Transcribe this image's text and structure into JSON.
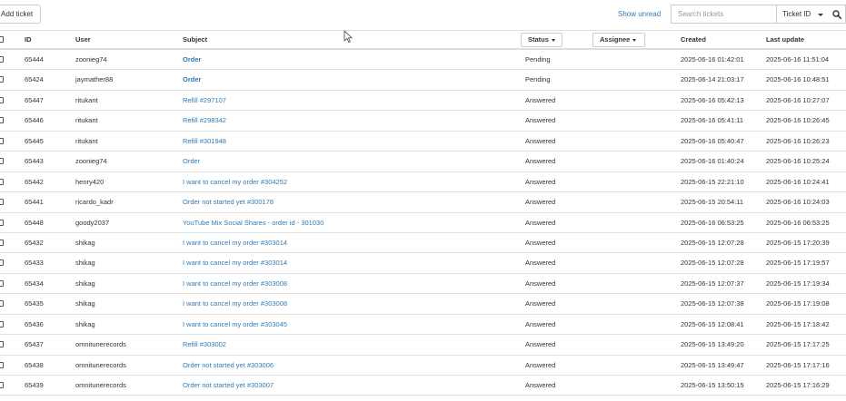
{
  "toolbar": {
    "add_ticket_label": "Add ticket",
    "show_unread_label": "Show unread",
    "search_placeholder": "Search tickets",
    "search_field_selected": "Ticket ID"
  },
  "table": {
    "headers": {
      "id": "ID",
      "user": "User",
      "subject": "Subject",
      "status": "Status",
      "assignee": "Assignee",
      "created": "Created",
      "last_update": "Last update"
    },
    "rows": [
      {
        "id": "65444",
        "user": "zoonieg74",
        "subject": "Order",
        "unread": true,
        "status": "Pending",
        "created": "2025-06-16 01:42:01",
        "updated": "2025-06-16 11:51:04"
      },
      {
        "id": "65424",
        "user": "jaymather88",
        "subject": "Order",
        "unread": true,
        "status": "Pending",
        "created": "2025-06-14 21:03:17",
        "updated": "2025-06-16 10:48:51"
      },
      {
        "id": "65447",
        "user": "ritukant",
        "subject": "Refill #297107",
        "unread": false,
        "status": "Answered",
        "created": "2025-06-16 05:42:13",
        "updated": "2025-06-16 10:27:07"
      },
      {
        "id": "65446",
        "user": "ritukant",
        "subject": "Refill #298342",
        "unread": false,
        "status": "Answered",
        "created": "2025-06-16 05:41:11",
        "updated": "2025-06-16 10:26:45"
      },
      {
        "id": "65445",
        "user": "ritukant",
        "subject": "Refill #301948",
        "unread": false,
        "status": "Answered",
        "created": "2025-06-16 05:40:47",
        "updated": "2025-06-16 10:26:23"
      },
      {
        "id": "65443",
        "user": "zoonieg74",
        "subject": "Order",
        "unread": false,
        "status": "Answered",
        "created": "2025-06-16 01:40:24",
        "updated": "2025-06-16 10:25:24"
      },
      {
        "id": "65442",
        "user": "henry420",
        "subject": "I want to cancel my order #304252",
        "unread": false,
        "status": "Answered",
        "created": "2025-06-15 22:21:10",
        "updated": "2025-06-16 10:24:41"
      },
      {
        "id": "65441",
        "user": "ricardo_kadr",
        "subject": "Order not started yet #300178",
        "unread": false,
        "status": "Answered",
        "created": "2025-06-15 20:54:11",
        "updated": "2025-06-16 10:24:03"
      },
      {
        "id": "65448",
        "user": "goody2037",
        "subject": "YouTube Mix Social Shares - order id - 301030",
        "unread": false,
        "status": "Answered",
        "created": "2025-06-16 06:53:25",
        "updated": "2025-06-16 06:53:25"
      },
      {
        "id": "65432",
        "user": "shikag",
        "subject": "I want to cancel my order #303014",
        "unread": false,
        "status": "Answered",
        "created": "2025-06-15 12:07:28",
        "updated": "2025-06-15 17:20:39"
      },
      {
        "id": "65433",
        "user": "shikag",
        "subject": "I want to cancel my order #303014",
        "unread": false,
        "status": "Answered",
        "created": "2025-06-15 12:07:28",
        "updated": "2025-06-15 17:19:57"
      },
      {
        "id": "65434",
        "user": "shikag",
        "subject": "I want to cancel my order #303008",
        "unread": false,
        "status": "Answered",
        "created": "2025-06-15 12:07:37",
        "updated": "2025-06-15 17:19:34"
      },
      {
        "id": "65435",
        "user": "shikag",
        "subject": "I want to cancel my order #303008",
        "unread": false,
        "status": "Answered",
        "created": "2025-06-15 12:07:38",
        "updated": "2025-06-15 17:19:08"
      },
      {
        "id": "65436",
        "user": "shikag",
        "subject": "I want to cancel my order #303045",
        "unread": false,
        "status": "Answered",
        "created": "2025-06-15 12:08:41",
        "updated": "2025-06-15 17:18:42"
      },
      {
        "id": "65437",
        "user": "omnitunerecords",
        "subject": "Refill #303002",
        "unread": false,
        "status": "Answered",
        "created": "2025-06-15 13:49:20",
        "updated": "2025-06-15 17:17:25"
      },
      {
        "id": "65438",
        "user": "omnitunerecords",
        "subject": "Order not started yet #303006",
        "unread": false,
        "status": "Answered",
        "created": "2025-06-15 13:49:47",
        "updated": "2025-06-15 17:17:16"
      },
      {
        "id": "65439",
        "user": "omnitunerecords",
        "subject": "Order not started yet #303007",
        "unread": false,
        "status": "Answered",
        "created": "2025-06-15 13:50:15",
        "updated": "2025-06-15 17:16:29"
      }
    ]
  },
  "colors": {
    "link": "#337ab7",
    "text": "#333333",
    "border": "#dddddd"
  },
  "icons": {
    "search": "search-icon",
    "caret": "caret-down-icon",
    "cursor": "mouse-cursor-icon"
  }
}
